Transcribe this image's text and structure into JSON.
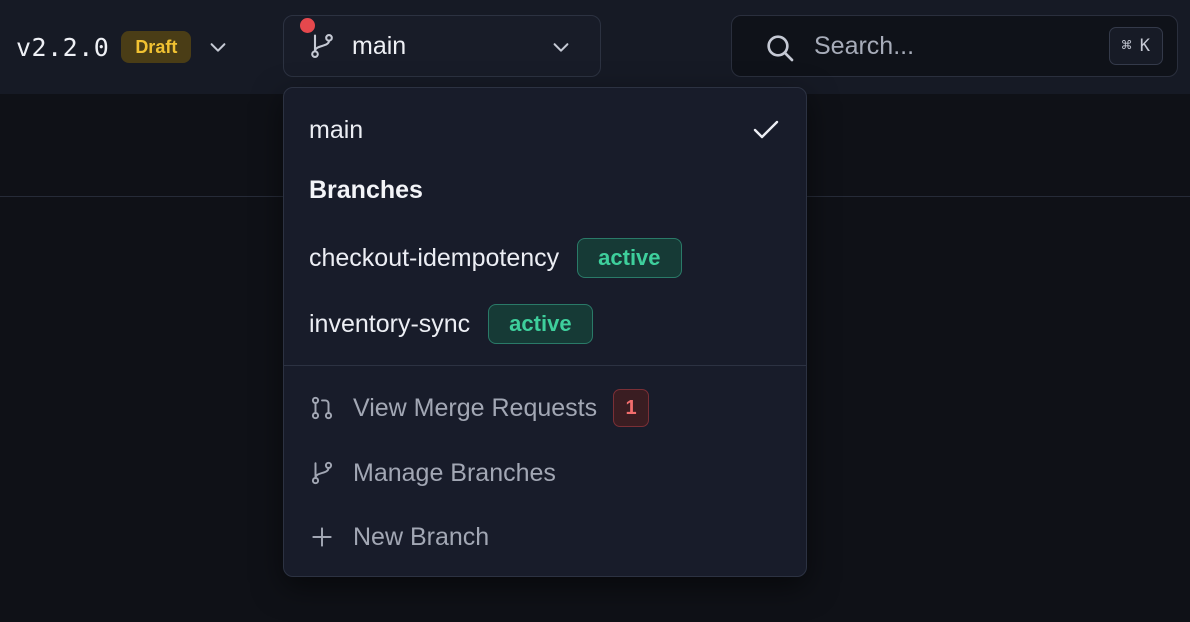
{
  "header": {
    "version": "v2.2.0",
    "status_badge": "Draft",
    "branch_selector": {
      "current": "main",
      "has_notification": true
    },
    "search": {
      "placeholder": "Search...",
      "shortcut_symbol": "⌘",
      "shortcut_key": "K"
    }
  },
  "branch_menu": {
    "current_branch": "main",
    "branches_heading": "Branches",
    "branches": [
      {
        "name": "checkout-idempotency",
        "badge": "active"
      },
      {
        "name": "inventory-sync",
        "badge": "active"
      }
    ],
    "actions": [
      {
        "label": "View Merge Requests",
        "icon": "merge-request-icon",
        "count": "1"
      },
      {
        "label": "Manage Branches",
        "icon": "branch-icon"
      },
      {
        "label": "New Branch",
        "icon": "plus-icon"
      }
    ]
  },
  "colors": {
    "topbar_bg": "#161a25",
    "page_bg": "#0f1117",
    "draft_badge_text": "#f1c232",
    "active_badge_text": "#3ecf9c",
    "count_badge_text": "#f26d6d",
    "notification_dot": "#e5484d"
  }
}
